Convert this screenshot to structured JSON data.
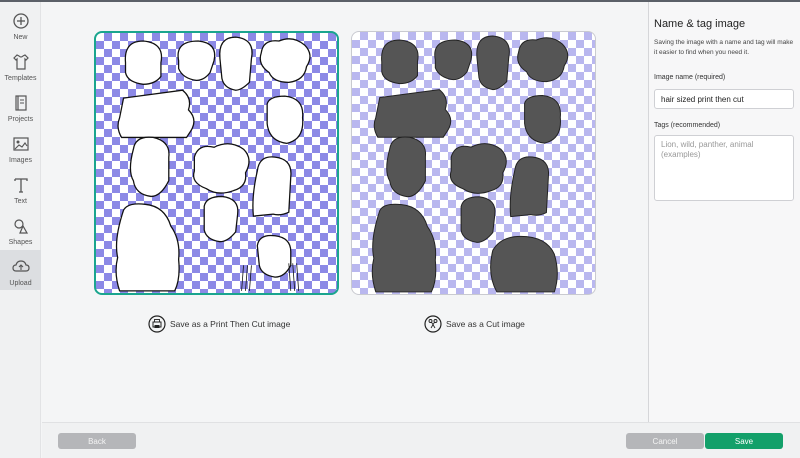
{
  "sidebar": {
    "items": [
      {
        "label": "New",
        "icon": "plus-circle-icon"
      },
      {
        "label": "Templates",
        "icon": "shirt-icon"
      },
      {
        "label": "Projects",
        "icon": "book-icon"
      },
      {
        "label": "Images",
        "icon": "image-icon"
      },
      {
        "label": "Text",
        "icon": "text-icon"
      },
      {
        "label": "Shapes",
        "icon": "shapes-icon"
      },
      {
        "label": "Upload",
        "icon": "cloud-upload-icon"
      }
    ],
    "active": "Upload"
  },
  "options": {
    "print_then_cut": "Save as a Print Then Cut image",
    "cut": "Save as a Cut image"
  },
  "right_panel": {
    "title": "Name & tag image",
    "description": "Saving the image with a name and tag will make it easier to find when you need it.",
    "name_label": "Image name (required)",
    "name_value": "hair sized print then cut",
    "tags_label": "Tags (recommended)",
    "tags_placeholder": "Lion, wild, panther, animal (examples)"
  },
  "footer": {
    "back": "Back",
    "cancel": "Cancel",
    "save": "Save"
  },
  "colors": {
    "accent": "#13a06a",
    "selected_border": "#1aa58e",
    "silhouette": "#555555"
  }
}
